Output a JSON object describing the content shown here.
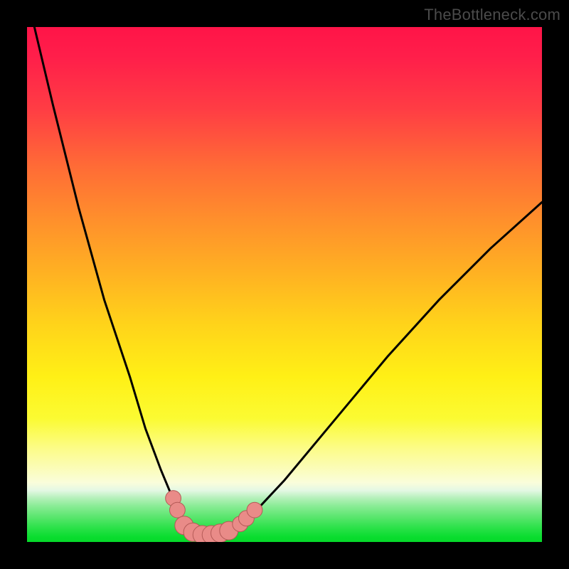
{
  "attribution": "TheBottleneck.com",
  "colors": {
    "frame": "#000000",
    "curve": "#000000",
    "marker_fill": "#e98b88",
    "marker_stroke": "#b45a57",
    "gradient_top": "#ff1448",
    "gradient_bottom": "#06d92a"
  },
  "chart_data": {
    "type": "line",
    "title": "",
    "xlabel": "",
    "ylabel": "",
    "xlim": [
      0,
      100
    ],
    "ylim": [
      0,
      100
    ],
    "grid": false,
    "legend": false,
    "series": [
      {
        "name": "bottleneck-curve",
        "x": [
          0,
          5,
          10,
          15,
          20,
          23,
          26,
          28.5,
          30,
          32,
          34,
          36,
          38,
          40,
          43,
          50,
          60,
          70,
          80,
          90,
          100
        ],
        "y": [
          106,
          85,
          65,
          47,
          32,
          22,
          14,
          8,
          4.5,
          2.3,
          1.4,
          1.3,
          1.5,
          2.2,
          4.5,
          12,
          24,
          36,
          47,
          57,
          66
        ]
      }
    ],
    "markers": [
      {
        "name": "left-upper",
        "x": 28.4,
        "y": 8.5,
        "r": 1.5
      },
      {
        "name": "left-lower",
        "x": 29.2,
        "y": 6.2,
        "r": 1.5
      },
      {
        "name": "trough-1",
        "x": 30.5,
        "y": 3.2,
        "r": 1.8
      },
      {
        "name": "trough-2",
        "x": 32.2,
        "y": 1.9,
        "r": 1.8
      },
      {
        "name": "trough-3",
        "x": 34.0,
        "y": 1.4,
        "r": 1.8
      },
      {
        "name": "trough-4",
        "x": 35.8,
        "y": 1.4,
        "r": 1.8
      },
      {
        "name": "trough-5",
        "x": 37.5,
        "y": 1.7,
        "r": 1.8
      },
      {
        "name": "trough-6",
        "x": 39.2,
        "y": 2.2,
        "r": 1.8
      },
      {
        "name": "right-lower",
        "x": 41.4,
        "y": 3.5,
        "r": 1.5
      },
      {
        "name": "right-mid",
        "x": 42.6,
        "y": 4.6,
        "r": 1.5
      },
      {
        "name": "right-upper",
        "x": 44.2,
        "y": 6.2,
        "r": 1.5
      }
    ]
  }
}
